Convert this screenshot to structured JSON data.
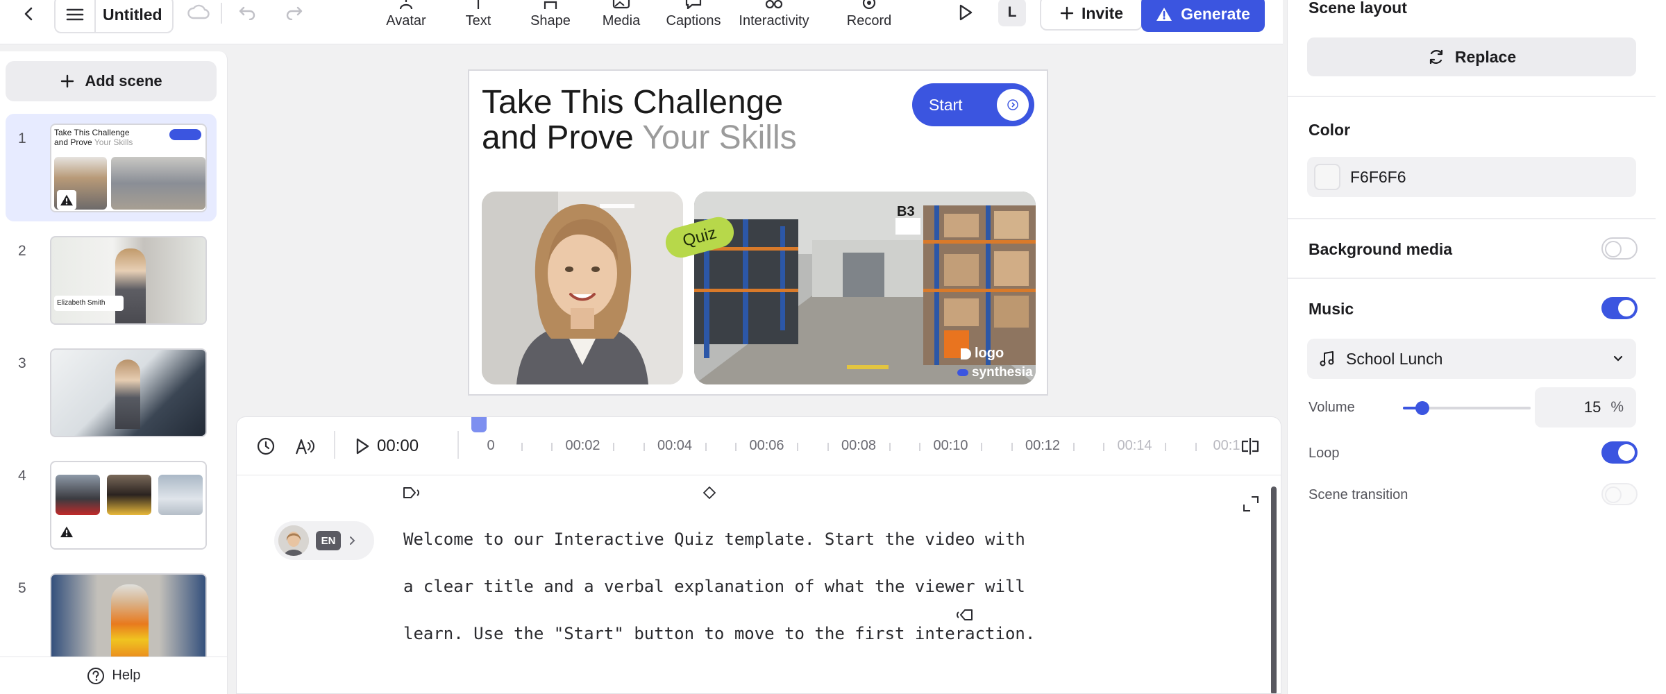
{
  "topbar": {
    "doc_title": "Untitled",
    "tools": [
      {
        "label": "Avatar",
        "icon": "avatar-icon"
      },
      {
        "label": "Text",
        "icon": "text-icon"
      },
      {
        "label": "Shape",
        "icon": "shape-icon"
      },
      {
        "label": "Media",
        "icon": "media-icon"
      },
      {
        "label": "Captions",
        "icon": "captions-icon"
      },
      {
        "label": "Interactivity",
        "icon": "interactivity-icon"
      },
      {
        "label": "Record",
        "icon": "record-icon"
      }
    ],
    "user_initial": "L",
    "invite_label": "Invite",
    "generate_label": "Generate",
    "accent_color": "#3b55e0"
  },
  "scenes": {
    "add_label": "Add scene",
    "items": [
      {
        "number": "1",
        "title_line1": "Take This Challenge",
        "title_line2a": "and Prove",
        "title_line2b": "Your Skills"
      },
      {
        "number": "2",
        "name_tag": "Elizabeth Smith"
      },
      {
        "number": "3"
      },
      {
        "number": "4"
      },
      {
        "number": "5"
      }
    ],
    "help_label": "Help"
  },
  "canvas": {
    "title_line1": "Take This Challenge",
    "title_line2a": "and Prove",
    "title_line2b": "Your Skills",
    "start_label": "Start",
    "quiz_label": "Quiz",
    "sign_label": "B3",
    "logo_label": "logo",
    "brand_label": "synthesia",
    "background_color": "#F6F6F6"
  },
  "timeline": {
    "current_time": "00:00",
    "ticks": [
      "0",
      "00:02",
      "00:04",
      "00:06",
      "00:08",
      "00:10",
      "00:12",
      "00:14",
      "00:1"
    ]
  },
  "script": {
    "language": "EN",
    "lines": [
      "Welcome to our Interactive Quiz template. Start the video with",
      "a clear title and a verbal explanation of what the viewer will",
      "learn. Use the \"Start\" button to move to the first interaction."
    ]
  },
  "properties": {
    "scene_layout_title": "Scene layout",
    "replace_label": "Replace",
    "color_title": "Color",
    "color_value": "F6F6F6",
    "background_media_label": "Background media",
    "background_media_on": false,
    "music_title": "Music",
    "music_on": true,
    "music_track": "School Lunch",
    "volume_label": "Volume",
    "volume_value": "15",
    "volume_unit": "%",
    "volume_fraction": 0.15,
    "loop_label": "Loop",
    "loop_on": true,
    "scene_transition_label": "Scene transition",
    "scene_transition_on": false
  }
}
